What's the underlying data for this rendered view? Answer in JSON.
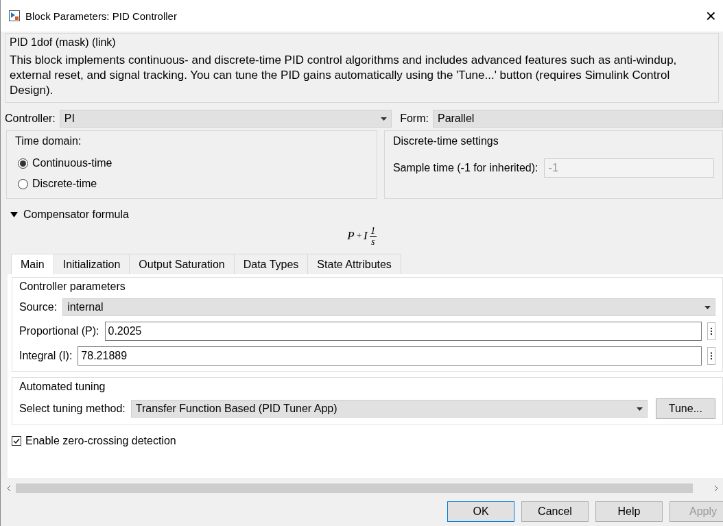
{
  "window": {
    "title": "Block Parameters: PID Controller",
    "close": "×"
  },
  "mask": {
    "title": "PID 1dof (mask) (link)",
    "description": "This block implements continuous- and discrete-time PID control algorithms and includes advanced features such as anti-windup, external reset, and signal tracking. You can tune the PID gains automatically using the 'Tune...' button (requires Simulink Control Design)."
  },
  "controller": {
    "label": "Controller:",
    "value": "PI"
  },
  "form": {
    "label": "Form:",
    "value": "Parallel"
  },
  "time_domain": {
    "title": "Time domain:",
    "options": [
      {
        "label": "Continuous-time",
        "selected": true
      },
      {
        "label": "Discrete-time",
        "selected": false
      }
    ]
  },
  "discrete_settings": {
    "title": "Discrete-time settings",
    "label": "Sample time (-1 for inherited):",
    "value": "-1",
    "disabled": true
  },
  "compensator": {
    "label": "Compensator formula",
    "expanded": true,
    "formula": {
      "p": "P",
      "plus": "+",
      "i": "I",
      "numerator": "1",
      "denominator": "s"
    }
  },
  "tabs": [
    {
      "label": "Main",
      "selected": true
    },
    {
      "label": "Initialization",
      "selected": false
    },
    {
      "label": "Output Saturation",
      "selected": false
    },
    {
      "label": "Data Types",
      "selected": false
    },
    {
      "label": "State Attributes",
      "selected": false
    }
  ],
  "controller_parameters": {
    "title": "Controller parameters",
    "fields": [
      {
        "kind": "select",
        "label": "Source:",
        "value": "internal"
      },
      {
        "kind": "text",
        "label": "Proportional (P):",
        "value": "0.2025"
      },
      {
        "kind": "text",
        "label": "Integral (I):",
        "value": "78.21889"
      }
    ]
  },
  "automated_tuning": {
    "title": "Automated tuning",
    "label": "Select tuning method:",
    "value": "Transfer Function Based (PID Tuner App)",
    "button": "Tune..."
  },
  "zero_crossing": {
    "label": "Enable zero-crossing detection",
    "checked": true
  },
  "buttons": [
    {
      "label": "OK",
      "default": true,
      "disabled": false
    },
    {
      "label": "Cancel",
      "default": false,
      "disabled": false
    },
    {
      "label": "Help",
      "default": false,
      "disabled": false
    },
    {
      "label": "Apply",
      "default": false,
      "disabled": true
    }
  ]
}
